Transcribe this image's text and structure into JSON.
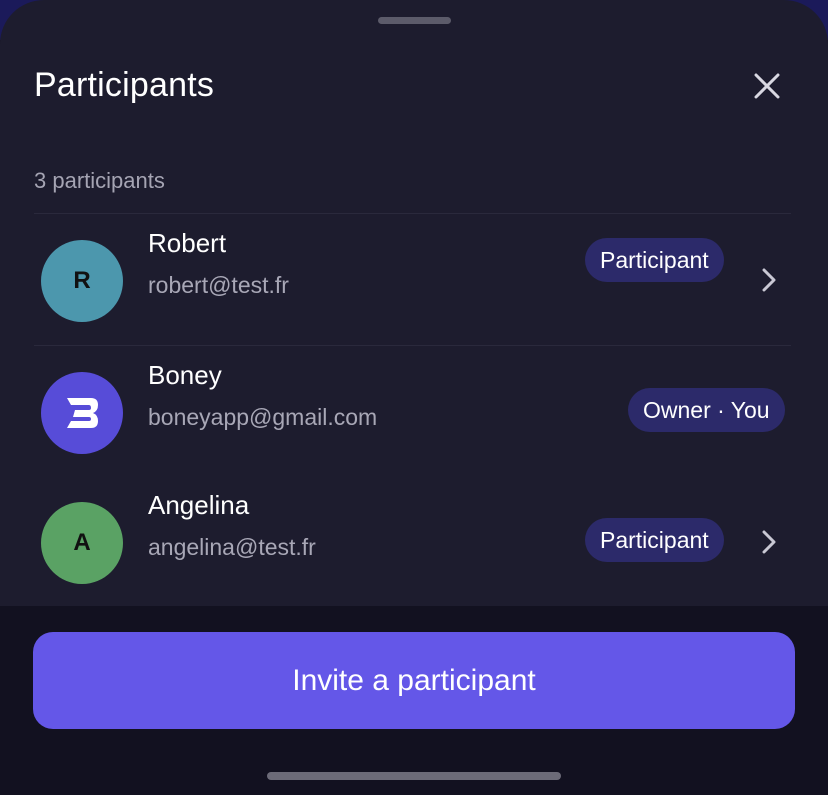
{
  "colors": {
    "sheet_bg": "#1d1c2e",
    "footer_bg": "#121120",
    "badge_bg": "#2c2a6a",
    "accent": "#6457e8",
    "text_primary": "#ffffff",
    "text_secondary": "#a8a7b6"
  },
  "header": {
    "title": "Participants",
    "close_icon": "close-icon"
  },
  "list": {
    "count_label": "3 participants",
    "participants": [
      {
        "initial": "R",
        "avatar_color": "#4c97ad",
        "name": "Robert",
        "email": "robert@test.fr",
        "role": "Participant",
        "chevron_icon": "chevron-right-icon"
      },
      {
        "initial": "B",
        "avatar_color": "#574cd8",
        "avatar_icon": "boney-logo-icon",
        "name": "Boney",
        "email": "boneyapp@gmail.com",
        "role": "Owner · You"
      },
      {
        "initial": "A",
        "avatar_color": "#5aa264",
        "name": "Angelina",
        "email": "angelina@test.fr",
        "role": "Participant",
        "chevron_icon": "chevron-right-icon"
      }
    ]
  },
  "footer": {
    "invite_label": "Invite a participant"
  }
}
